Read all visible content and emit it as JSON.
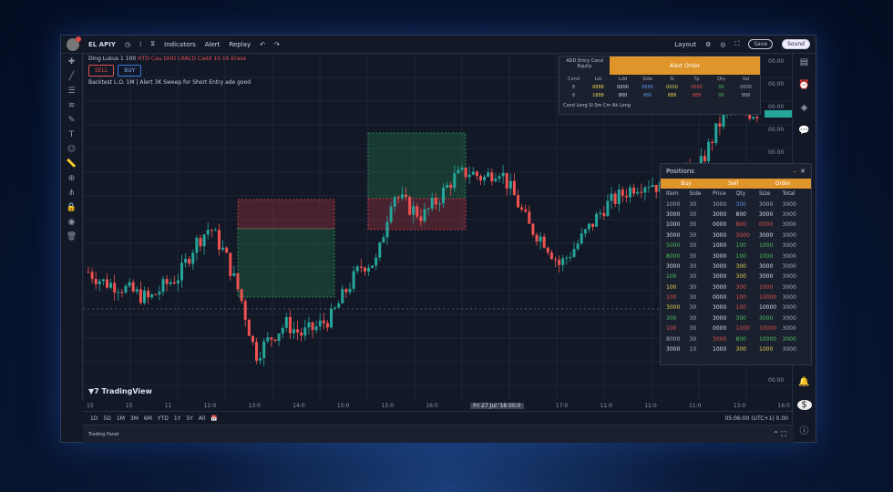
{
  "toolbar": {
    "symbol": "EL APIY",
    "items": [
      "Indicators",
      "Alert",
      "Replay"
    ],
    "right_label": "Layout",
    "publish": "Save",
    "share": "Sound"
  },
  "legend": {
    "line1": "Ding  Lukus  1  100",
    "line1_red": "HTD  Cau  DHD  LRACD  Cadd 10  16 Erase",
    "line2": "Backtest L.O. 1M  | Alert 3K  Sweep for Short Entry ade good",
    "sell": "SELL",
    "buy": "BUY"
  },
  "info": {
    "title": "ADD Entry Cond",
    "sub": "Equity",
    "button": "Alert Order",
    "headers": [
      "Cond",
      "Lot",
      "Ldd",
      "Side",
      "Sl",
      "Tp",
      "Qty",
      "Val"
    ],
    "rows": [
      [
        "8",
        "8888",
        "0000",
        "8888",
        "0000",
        "0000",
        "00",
        "0000"
      ],
      [
        "8",
        "1888",
        "800",
        "886",
        "888",
        "888",
        "00",
        "888"
      ]
    ],
    "footer": "Cond Long  Sl Sm  Cm  Ak Long"
  },
  "book": {
    "title": "Positions",
    "tabs": [
      "Buy",
      "Sell",
      "Order"
    ],
    "headers": [
      "Item",
      "Side",
      "Price",
      "Qty",
      "Size",
      "Total"
    ],
    "rows": [
      [
        "1000",
        "30",
        "3000",
        "300",
        "3000",
        "3000"
      ],
      [
        "3000",
        "30",
        "3000",
        "800",
        "3000",
        "3000"
      ],
      [
        "1000",
        "30",
        "0000",
        "800",
        "0000",
        "3000"
      ],
      [
        "3000",
        "30",
        "3000",
        "3000",
        "3000",
        "3000"
      ],
      [
        "5000",
        "30",
        "1000",
        "100",
        "1000",
        "3000"
      ],
      [
        "8000",
        "30",
        "3000",
        "100",
        "1000",
        "3000"
      ],
      [
        "3000",
        "30",
        "3000",
        "300",
        "3000",
        "3000"
      ],
      [
        "100",
        "30",
        "3000",
        "300",
        "3000",
        "3000"
      ],
      [
        "100",
        "30",
        "3000",
        "300",
        "1000",
        "3000"
      ],
      [
        "100",
        "30",
        "0000",
        "100",
        "10000",
        "3000"
      ],
      [
        "3000",
        "30",
        "3000",
        "100",
        "10000",
        "3000"
      ],
      [
        "300",
        "30",
        "3000",
        "300",
        "3000",
        "3000"
      ],
      [
        "100",
        "30",
        "0000",
        "1000",
        "10000",
        "3000"
      ],
      [
        "8000",
        "30",
        "3000",
        "800",
        "10000",
        "3000"
      ],
      [
        "3000",
        "10",
        "1000",
        "300",
        "1000",
        "3000"
      ]
    ],
    "colors": [
      [
        "#aab",
        "#aab",
        "#aab",
        "#5a8fe0",
        "#aab",
        "#aab"
      ],
      [
        "#dde",
        "#aab",
        "#dde",
        "#dde",
        "#dde",
        "#aab"
      ],
      [
        "#dde",
        "#aab",
        "#dde",
        "#e05050",
        "#e05050",
        "#aab"
      ],
      [
        "#dde",
        "#aab",
        "#dde",
        "#e05050",
        "#dde",
        "#aab"
      ],
      [
        "#4cc060",
        "#aab",
        "#dde",
        "#4cc060",
        "#4cc060",
        "#aab"
      ],
      [
        "#4cc060",
        "#aab",
        "#dde",
        "#4cc060",
        "#4cc060",
        "#aab"
      ],
      [
        "#dde",
        "#aab",
        "#dde",
        "#e0d050",
        "#dde",
        "#aab"
      ],
      [
        "#4cc060",
        "#aab",
        "#dde",
        "#e0d050",
        "#dde",
        "#aab"
      ],
      [
        "#e0d050",
        "#aab",
        "#dde",
        "#e05050",
        "#e05050",
        "#aab"
      ],
      [
        "#e05050",
        "#aab",
        "#dde",
        "#e05050",
        "#e05050",
        "#aab"
      ],
      [
        "#e0d050",
        "#aab",
        "#dde",
        "#e05050",
        "#dde",
        "#aab"
      ],
      [
        "#4cc060",
        "#aab",
        "#dde",
        "#4cc060",
        "#4cc060",
        "#aab"
      ],
      [
        "#e05050",
        "#aab",
        "#dde",
        "#e05050",
        "#e05050",
        "#aab"
      ],
      [
        "#aab",
        "#aab",
        "#e05050",
        "#4cc060",
        "#4cc060",
        "#4cc060"
      ],
      [
        "#dde",
        "#aab",
        "#dde",
        "#e0d050",
        "#e0d050",
        "#aab"
      ]
    ]
  },
  "price_axis": [
    "00.00",
    "00.00",
    "00.00",
    "00.00",
    "00.00",
    "00.00",
    "00.00",
    "00.00",
    "00.00",
    "00.00",
    "00.00",
    "00.00",
    "00.00",
    "00.00",
    "00.00"
  ],
  "time_axis": [
    "15",
    "15",
    "11",
    "12:0",
    "13:0",
    "14:0",
    "15:0",
    "15:0",
    "16:0",
    "Fri 27 Jul '18  00:0",
    "17:0",
    "11:0",
    "11:0",
    "11:0",
    "13:0",
    "16:0"
  ],
  "timeframes": [
    "1D",
    "5D",
    "1M",
    "3M",
    "6M",
    "YTD",
    "1Y",
    "5Y",
    "All"
  ],
  "bottom_right": "05:06:00 (UTC+1) 0.00",
  "footer": "Trading Panel",
  "brand": "TradingView",
  "chart_data": {
    "type": "candlestick",
    "keypoints": [
      37,
      34,
      33,
      31,
      29,
      33,
      36,
      45,
      50,
      42,
      30,
      13,
      18,
      22,
      19,
      21,
      24,
      32,
      39,
      40,
      60,
      56,
      53,
      58,
      64,
      66,
      64,
      67,
      59,
      50,
      46,
      39,
      44,
      50,
      56,
      59,
      62,
      63,
      60,
      66,
      65,
      75,
      84,
      83,
      83
    ],
    "colors": {
      "up": "#26a69a",
      "down": "#ef5350",
      "bg": "#121826"
    }
  }
}
